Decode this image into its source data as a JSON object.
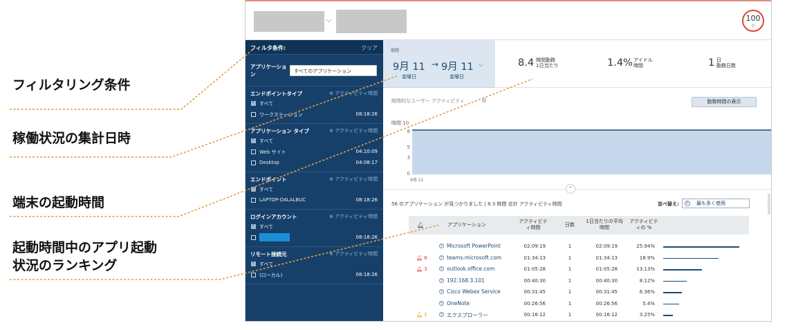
{
  "annotations": {
    "filter": "フィルタリング条件",
    "aggregate_date": "稼働状況の集計日時",
    "boot_time": "端末の起動時間",
    "ranking_line1": "起動時間中のアプリ起動",
    "ranking_line2": "状況のランキング"
  },
  "header": {
    "score_value": "100",
    "score_sub": "0"
  },
  "sidebar": {
    "title": "フィルタ条件:",
    "clear": "クリア",
    "application_label": "アプリケーション",
    "application_value": "すべてのアプリケーション",
    "sections": [
      {
        "title": "エンドポイントタイプ",
        "action": "アクティビティ時間",
        "rows": [
          {
            "label": "すべて",
            "checked": true,
            "value": ""
          },
          {
            "label": "ワークステーション",
            "checked": false,
            "value": "08:18:26"
          }
        ]
      },
      {
        "title": "アプリケーション タイプ",
        "action": "アクティビティ時間",
        "rows": [
          {
            "label": "すべて",
            "checked": true,
            "value": ""
          },
          {
            "label": "Web サイト",
            "checked": false,
            "value": "04:10:09"
          },
          {
            "label": "Desktop",
            "checked": false,
            "value": "04:08:17"
          }
        ]
      },
      {
        "title": "エンドポイント",
        "action": "アクティビティ時間",
        "rows": [
          {
            "label": "すべて",
            "checked": true,
            "value": ""
          },
          {
            "label": "LAPTOP-O4LALBUC",
            "checked": false,
            "value": "08:18:26"
          }
        ]
      },
      {
        "title": "ログインアカウント",
        "action": "アクティビティ時間",
        "rows": [
          {
            "label": "すべて",
            "checked": true,
            "value": ""
          },
          {
            "label": "",
            "checked": false,
            "value": "08:18:26"
          }
        ]
      },
      {
        "title": "リモート接続元",
        "action": "アクティビティ時間",
        "rows": [
          {
            "label": "すべて",
            "checked": true,
            "value": ""
          },
          {
            "label": "(ローカル)",
            "checked": false,
            "value": "08:18:26"
          }
        ]
      }
    ]
  },
  "period": {
    "caption": "期間",
    "start_date": "9月 11",
    "arrow": "→",
    "end_date": "9月 11",
    "start_weekday": "金曜日",
    "end_weekday": "金曜日"
  },
  "kpis": [
    {
      "value": "8.4",
      "label_top": "時間勤務",
      "label_bottom": "1日当たり"
    },
    {
      "value": "1.4%",
      "label_top": "アイドル",
      "label_bottom": "時間"
    },
    {
      "value": "1",
      "label_top": "日",
      "label_bottom": "勤務日数"
    }
  ],
  "trend": {
    "label": "経時的なユーザー アクティビティ",
    "work_button": "勤務時間の表示"
  },
  "chart_data": {
    "type": "area",
    "ylabel": "時間",
    "y_max_label": "10",
    "yticks": [
      8,
      5,
      3,
      0
    ],
    "ylim": [
      0,
      8.4
    ],
    "x": [
      "9月 11"
    ],
    "values": [
      8.4
    ],
    "grid": true,
    "color": "#c7d8ec"
  },
  "summary": {
    "count_text": "56 のアプリケーション が見つかりました",
    "separator": "|",
    "total_text": "8.3 時間 合計 アクティビティ時間",
    "sort_label": "並べ替え:",
    "sort_value": "最も多く使用"
  },
  "table": {
    "headers": {
      "application": "アプリケーション",
      "activity_time": "アクティビテ\nィ時間",
      "days": "日数",
      "avg_per_day": "1日当たりの平均\n時間",
      "activity_pct": "アクティビテ\nィの %"
    },
    "rows": [
      {
        "alert": "",
        "alert_type": "",
        "name": "Microsoft PowerPoint",
        "activity": "02:09:19",
        "days": "1",
        "avg": "02:09:19",
        "pct": "25.94%",
        "pct_value": 25.94
      },
      {
        "alert": "8",
        "alert_type": "red",
        "name": "teams.microsoft.com",
        "activity": "01:34:13",
        "days": "1",
        "avg": "01:34:13",
        "pct": "18.9%",
        "pct_value": 18.9
      },
      {
        "alert": "3",
        "alert_type": "red",
        "name": "outlook.office.com",
        "activity": "01:05:28",
        "days": "1",
        "avg": "01:05:28",
        "pct": "13.13%",
        "pct_value": 13.13
      },
      {
        "alert": "",
        "alert_type": "",
        "name": "192.168.3.101",
        "activity": "00:40:30",
        "days": "1",
        "avg": "00:40:30",
        "pct": "8.12%",
        "pct_value": 8.12
      },
      {
        "alert": "",
        "alert_type": "",
        "name": "Cisco Webex Service",
        "activity": "00:31:45",
        "days": "1",
        "avg": "00:31:45",
        "pct": "6.36%",
        "pct_value": 6.36
      },
      {
        "alert": "",
        "alert_type": "",
        "name": "OneNote",
        "activity": "00:26:56",
        "days": "1",
        "avg": "00:26:56",
        "pct": "5.4%",
        "pct_value": 5.4
      },
      {
        "alert": "1",
        "alert_type": "warn",
        "name": "エクスプローラー",
        "activity": "00:16:12",
        "days": "1",
        "avg": "00:16:12",
        "pct": "3.25%",
        "pct_value": 3.25
      }
    ]
  }
}
